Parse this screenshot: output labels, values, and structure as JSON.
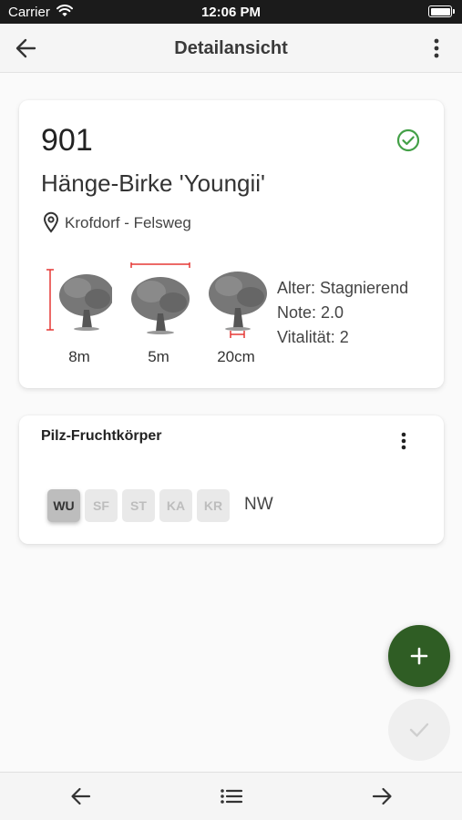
{
  "status_bar": {
    "carrier": "Carrier",
    "time": "12:06 PM",
    "wifi_icon": "wifi-icon",
    "battery_icon": "battery-icon"
  },
  "app_bar": {
    "title": "Detailansicht",
    "back_icon": "arrow-back-icon",
    "menu_icon": "more-vertical-icon"
  },
  "tree_card": {
    "number": "901",
    "name": "Hänge-Birke 'Youngii'",
    "location": "Krofdorf - Felsweg",
    "status_icon": "check-circle-icon",
    "status_color": "#43a047",
    "metrics": [
      {
        "icon": "tree-height-icon",
        "label": "8m"
      },
      {
        "icon": "tree-crown-width-icon",
        "label": "5m"
      },
      {
        "icon": "tree-trunk-diameter-icon",
        "label": "20cm"
      }
    ],
    "stats": [
      "Alter: Stagnierend",
      "Note: 2.0",
      "Vitalität: 2"
    ]
  },
  "pilz_card": {
    "title": "Pilz-Fruchtkörper",
    "menu_icon": "more-vertical-icon",
    "chips": [
      {
        "label": "WU",
        "active": true
      },
      {
        "label": "SF",
        "active": false
      },
      {
        "label": "ST",
        "active": false
      },
      {
        "label": "KA",
        "active": false
      },
      {
        "label": "KR",
        "active": false
      }
    ],
    "extra": "NW"
  },
  "fab": {
    "add_icon": "plus-icon",
    "add_color": "#2f5d24",
    "confirm_icon": "check-icon"
  },
  "bottom_nav": {
    "items": [
      "arrow-back-icon",
      "list-icon",
      "arrow-forward-icon"
    ]
  },
  "colors": {
    "measure_marker": "#e53935",
    "chip_active_bg": "#bdbdbd",
    "chip_inactive_bg": "#e9e9e9"
  }
}
